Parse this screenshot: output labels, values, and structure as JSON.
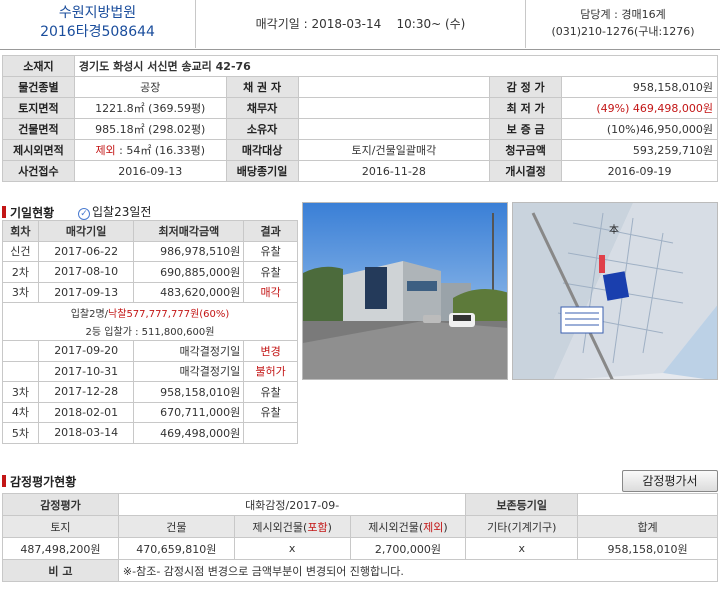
{
  "header": {
    "court": "수원지방법원",
    "case_no": "2016타경508644",
    "sale_label": "매각기일",
    "sale_date": "2018-03-14",
    "sale_time": "10:30~ (수)",
    "manager_label": "담당계",
    "manager_dept": "경매16계",
    "manager_phone": "(031)210-1276(구내:1276)"
  },
  "info": {
    "address_label": "소재지",
    "address": "경기도 화성시 서신면 송교리 42-76",
    "type_label": "물건종별",
    "type": "공장",
    "creditor_label": "채 권 자",
    "creditor": "",
    "appraisal_label": "감 정 가",
    "appraisal": "958,158,010원",
    "land_label": "토지면적",
    "land": "1221.8㎡ (369.59평)",
    "debtor_label": "채무자",
    "debtor": "",
    "min_label": "최 저 가",
    "min_pct": "(49%)",
    "min_price": "469,498,000원",
    "bldg_label": "건물면적",
    "bldg": "985.18㎡ (298.02평)",
    "owner_label": "소유자",
    "owner": "",
    "deposit_label": "보 증 금",
    "deposit": "(10%)46,950,000원",
    "excl_label": "제시외면적",
    "excl_tag": "제외",
    "excl": " : 54㎡ (16.33평)",
    "target_label": "매각대상",
    "target": "토지/건물일괄매각",
    "claim_label": "청구금액",
    "claim": "593,259,710원",
    "receipt_label": "사건접수",
    "receipt": "2016-09-13",
    "dividend_label": "배당종기일",
    "dividend": "2016-11-28",
    "start_label": "개시결정",
    "start": "2016-09-19"
  },
  "history": {
    "title": "기일현황",
    "check_label": "입찰",
    "check_days": "23",
    "check_suffix": "일전",
    "cols": [
      "회차",
      "매각기일",
      "최저매각금액",
      "결과"
    ],
    "rows": [
      {
        "round": "신건",
        "date": "2017-06-22",
        "amount": "986,978,510원",
        "result": "유찰",
        "red": false
      },
      {
        "round": "2차",
        "date": "2017-08-10",
        "amount": "690,885,000원",
        "result": "유찰",
        "red": false
      },
      {
        "round": "3차",
        "date": "2017-09-13",
        "amount": "483,620,000원",
        "result": "매각",
        "red": true
      }
    ],
    "note1_a": "입찰2명/",
    "note1_b": "낙찰577,777,777원(60%)",
    "note2": "2등 입찰가 : 511,800,600원",
    "rows2": [
      {
        "round": "",
        "date": "2017-09-20",
        "amount": "매각결정기일",
        "result": "변경",
        "red": true
      },
      {
        "round": "",
        "date": "2017-10-31",
        "amount": "매각결정기일",
        "result": "불허가",
        "red": true
      },
      {
        "round": "3차",
        "date": "2017-12-28",
        "amount": "958,158,010원",
        "result": "유찰",
        "red": false
      },
      {
        "round": "4차",
        "date": "2018-02-01",
        "amount": "670,711,000원",
        "result": "유찰",
        "red": false
      },
      {
        "round": "5차",
        "date": "2018-03-14",
        "amount": "469,498,000원",
        "result": "",
        "red": false
      }
    ]
  },
  "map_label": "本",
  "appraisal_section": {
    "title": "감정평가현황",
    "button": "감정평가서",
    "head_label": "감정평가",
    "head_value": "대화감정/2017-09-",
    "preserve_label": "보존등기일",
    "preserve_value": "",
    "cols": [
      "토지",
      "건물",
      "제시외건물(",
      "포함",
      ")",
      "제시외건물(",
      "제외",
      ")",
      "기타(기계기구)",
      "합계"
    ],
    "values": [
      "487,498,200원",
      "470,659,810원",
      "x",
      "2,700,000원",
      "x",
      "958,158,010원"
    ],
    "note_label": "비 고",
    "note": "※-참조- 감정시점 변경으로 금액부분이 변경되어 진행합니다."
  },
  "colors": {
    "red": "#c31616",
    "blue": "#1a4d9c",
    "label_bg": "#e4e4e4"
  }
}
